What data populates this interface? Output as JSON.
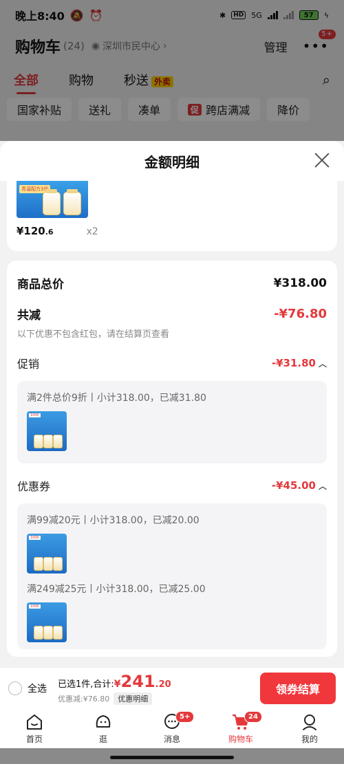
{
  "status_bar": {
    "time": "晚上8:40",
    "battery": "57",
    "network": "5G"
  },
  "header": {
    "title": "购物车",
    "count": "(24)",
    "location": "深圳市民中心",
    "manage": "管理",
    "more_badge": "5+"
  },
  "tabs": [
    {
      "label": "全部",
      "active": true
    },
    {
      "label": "购物"
    },
    {
      "label": "秒送",
      "tag": "外卖"
    }
  ],
  "filters": [
    "国家补贴",
    "送礼",
    "凑单",
    "跨店满减",
    "降价"
  ],
  "filter_cu_badge": "促",
  "sheet": {
    "title": "金额明细",
    "top_product": {
      "price_int": "¥120",
      "price_dec": ".6",
      "qty": "x2",
      "tag": "青温配方3代"
    },
    "total_label": "商品总价",
    "total_value": "¥318.00",
    "discount_label": "共减",
    "discount_value": "-¥76.80",
    "hint": "以下优惠不包含红包，请在结算页查看",
    "promo": {
      "label": "促销",
      "value": "-¥31.80",
      "lines": [
        "满2件总价9折丨小计318.00，已减31.80"
      ]
    },
    "coupon": {
      "label": "优惠券",
      "value": "-¥45.00",
      "lines": [
        "满99减20元丨小计318.00，已减20.00",
        "满249减25元丨小计318.00，已减25.00"
      ]
    }
  },
  "checkout": {
    "select_all": "全选",
    "selected_prefix": "已选1件,合计:",
    "yen": "¥",
    "total_int": "241",
    "total_dec": ".20",
    "reduced": "优惠减:¥76.80",
    "detail_button": "优惠明细",
    "pay_button": "领券结算"
  },
  "nav": [
    {
      "label": "首页",
      "icon": "home-icon"
    },
    {
      "label": "逛",
      "icon": "face-icon"
    },
    {
      "label": "消息",
      "icon": "message-icon",
      "badge": "5+"
    },
    {
      "label": "购物车",
      "icon": "cart-icon",
      "badge": "24",
      "active": true
    },
    {
      "label": "我的",
      "icon": "profile-icon"
    }
  ],
  "colors": {
    "accent": "#e4393c",
    "pay_button": "#f0373c",
    "battery": "#6fd35a"
  }
}
